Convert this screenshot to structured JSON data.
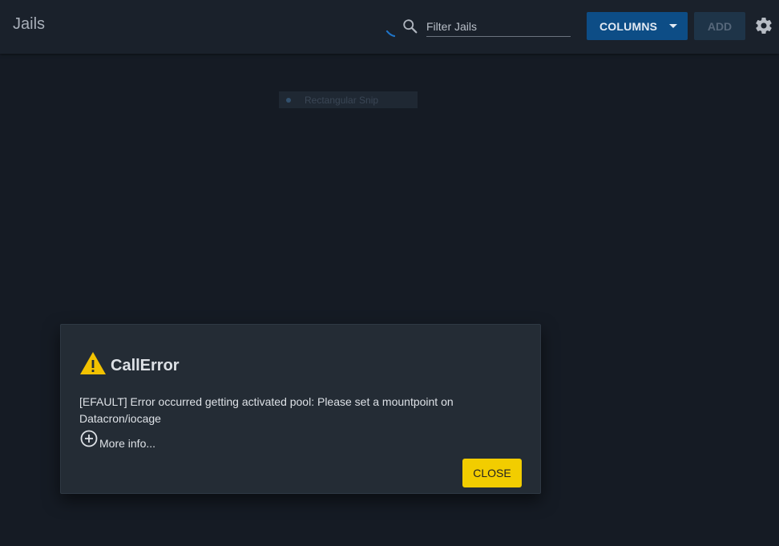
{
  "toolbar": {
    "title": "Jails",
    "search_placeholder": "Filter Jails",
    "columns_label": "COLUMNS",
    "add_label": "ADD"
  },
  "snip_overlay": {
    "label": "Rectangular Snip"
  },
  "dialog": {
    "title": "CallError",
    "message": "[EFAULT] Error occurred getting activated pool: Please set a mountpoint on Datacron/iocage",
    "more_info_label": "More info...",
    "close_label": "CLOSE"
  },
  "icons": {
    "search": "search-icon",
    "gear": "gear-icon",
    "warning": "warning-icon",
    "more_info": "plus-circle-icon",
    "caret": "chevron-down-icon",
    "spinner": "loading-spinner"
  },
  "colors": {
    "background": "#151b24",
    "toolbar": "#1a212b",
    "primary_button": "#0d4d86",
    "disabled_button": "#1e3448",
    "dialog": "#242c35",
    "warning": "#f2c200",
    "close_button": "#f2cd00"
  }
}
